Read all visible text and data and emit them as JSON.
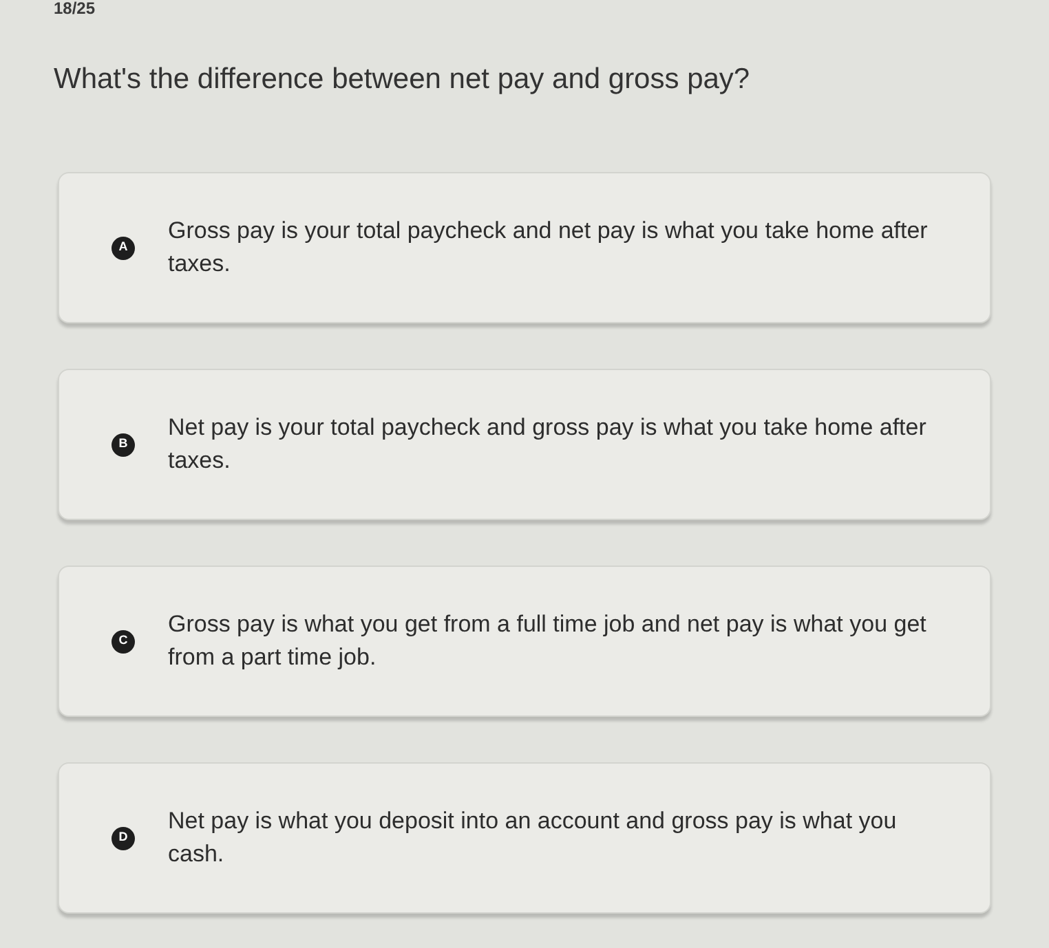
{
  "progress": "18/25",
  "question": "What's the difference between net pay and gross pay?",
  "options": [
    {
      "letter": "A",
      "text": "Gross pay is your total paycheck and net pay is what you take home after taxes."
    },
    {
      "letter": "B",
      "text": "Net pay is your total paycheck and gross pay is what you take home after taxes."
    },
    {
      "letter": "C",
      "text": "Gross pay is what you get from a full time job and net pay is what you get from a part time job."
    },
    {
      "letter": "D",
      "text": "Net pay is what you deposit into an account and gross pay is what you cash."
    }
  ]
}
